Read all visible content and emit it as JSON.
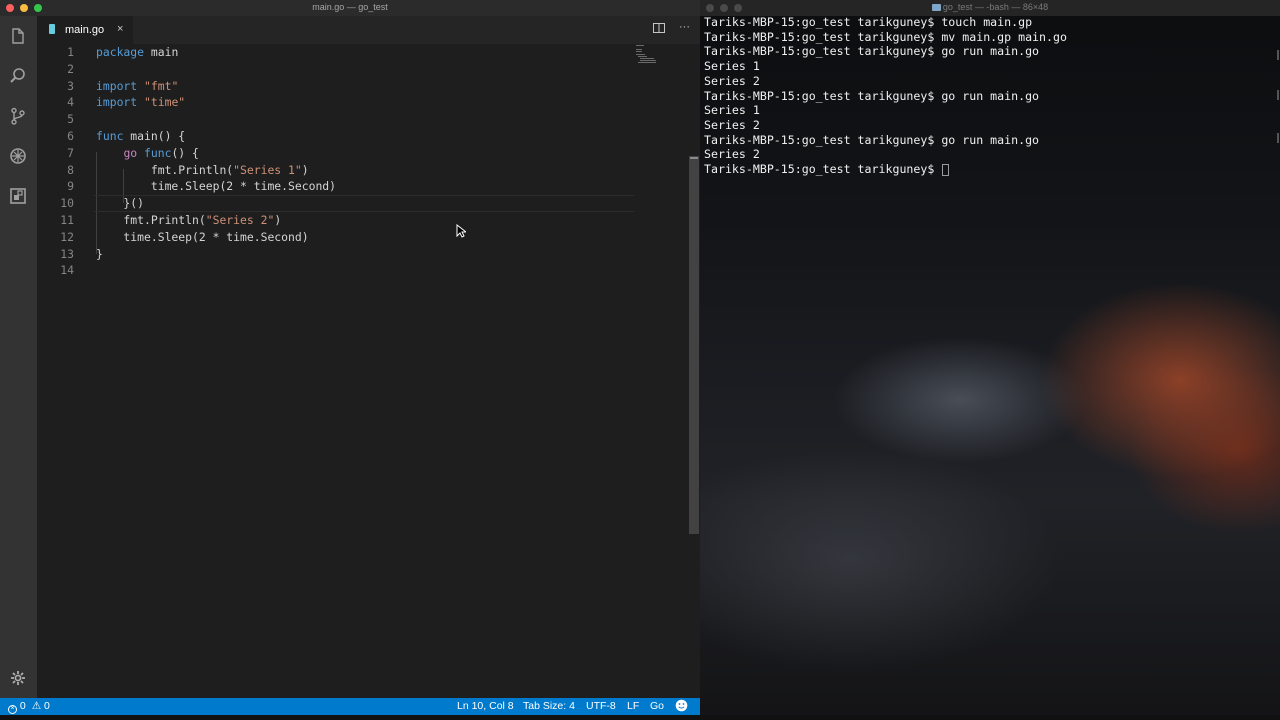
{
  "vscode": {
    "window_title": "main.go — go_test",
    "tab": {
      "label": "main.go",
      "close": "×"
    },
    "tab_actions": {
      "split": "split-editor-icon",
      "more": "···"
    },
    "code_lines": [
      {
        "n": "1",
        "tokens": [
          {
            "t": "package",
            "c": "kw2"
          },
          {
            "t": " main",
            "c": ""
          }
        ]
      },
      {
        "n": "2",
        "tokens": []
      },
      {
        "n": "3",
        "tokens": [
          {
            "t": "import",
            "c": "kw2"
          },
          {
            "t": " ",
            "c": ""
          },
          {
            "t": "\"fmt\"",
            "c": "str"
          }
        ]
      },
      {
        "n": "4",
        "tokens": [
          {
            "t": "import",
            "c": "kw2"
          },
          {
            "t": " ",
            "c": ""
          },
          {
            "t": "\"time\"",
            "c": "str"
          }
        ]
      },
      {
        "n": "5",
        "tokens": []
      },
      {
        "n": "6",
        "tokens": [
          {
            "t": "func",
            "c": "kw2"
          },
          {
            "t": " main() {",
            "c": ""
          }
        ]
      },
      {
        "n": "7",
        "tokens": [
          {
            "t": "    ",
            "c": ""
          },
          {
            "t": "go",
            "c": "kw"
          },
          {
            "t": " ",
            "c": ""
          },
          {
            "t": "func",
            "c": "kw2"
          },
          {
            "t": "() {",
            "c": ""
          }
        ]
      },
      {
        "n": "8",
        "tokens": [
          {
            "t": "        fmt.Println(",
            "c": ""
          },
          {
            "t": "\"Series 1\"",
            "c": "str"
          },
          {
            "t": ")",
            "c": ""
          }
        ]
      },
      {
        "n": "9",
        "tokens": [
          {
            "t": "        time.Sleep(2 * time.Second)",
            "c": ""
          }
        ]
      },
      {
        "n": "10",
        "tokens": [
          {
            "t": "    }()",
            "c": ""
          }
        ]
      },
      {
        "n": "11",
        "tokens": [
          {
            "t": "    fmt.Println(",
            "c": ""
          },
          {
            "t": "\"Series 2\"",
            "c": "str"
          },
          {
            "t": ")",
            "c": ""
          }
        ]
      },
      {
        "n": "12",
        "tokens": [
          {
            "t": "    time.Sleep(2 * time.Second)",
            "c": ""
          }
        ]
      },
      {
        "n": "13",
        "tokens": [
          {
            "t": "}",
            "c": ""
          }
        ]
      },
      {
        "n": "14",
        "tokens": []
      }
    ],
    "status": {
      "errors": "0",
      "warnings": "0",
      "position": "Ln 10, Col 8",
      "tab_size": "Tab Size: 4",
      "encoding": "UTF-8",
      "eol": "LF",
      "language": "Go"
    },
    "activity_icons": [
      "files-icon",
      "search-icon",
      "source-control-icon",
      "debug-icon",
      "extensions-icon",
      "gear-icon"
    ]
  },
  "terminal": {
    "window_title": "go_test — -bash — 86×48",
    "lines": [
      "Tariks-MBP-15:go_test tarikguney$ touch main.gp",
      "Tariks-MBP-15:go_test tarikguney$ mv main.gp main.go",
      "Tariks-MBP-15:go_test tarikguney$ go run main.go",
      "Series 1",
      "Series 2",
      "Tariks-MBP-15:go_test tarikguney$ go run main.go",
      "Series 1",
      "Series 2",
      "Tariks-MBP-15:go_test tarikguney$ go run main.go",
      "Series 2",
      "Tariks-MBP-15:go_test tarikguney$ "
    ]
  },
  "colors": {
    "statusbar": "#007acc",
    "editor_bg": "#1e1e1e",
    "activitybar": "#333333",
    "keyword": "#569cd6",
    "control": "#c586c0",
    "string": "#ce9178"
  }
}
